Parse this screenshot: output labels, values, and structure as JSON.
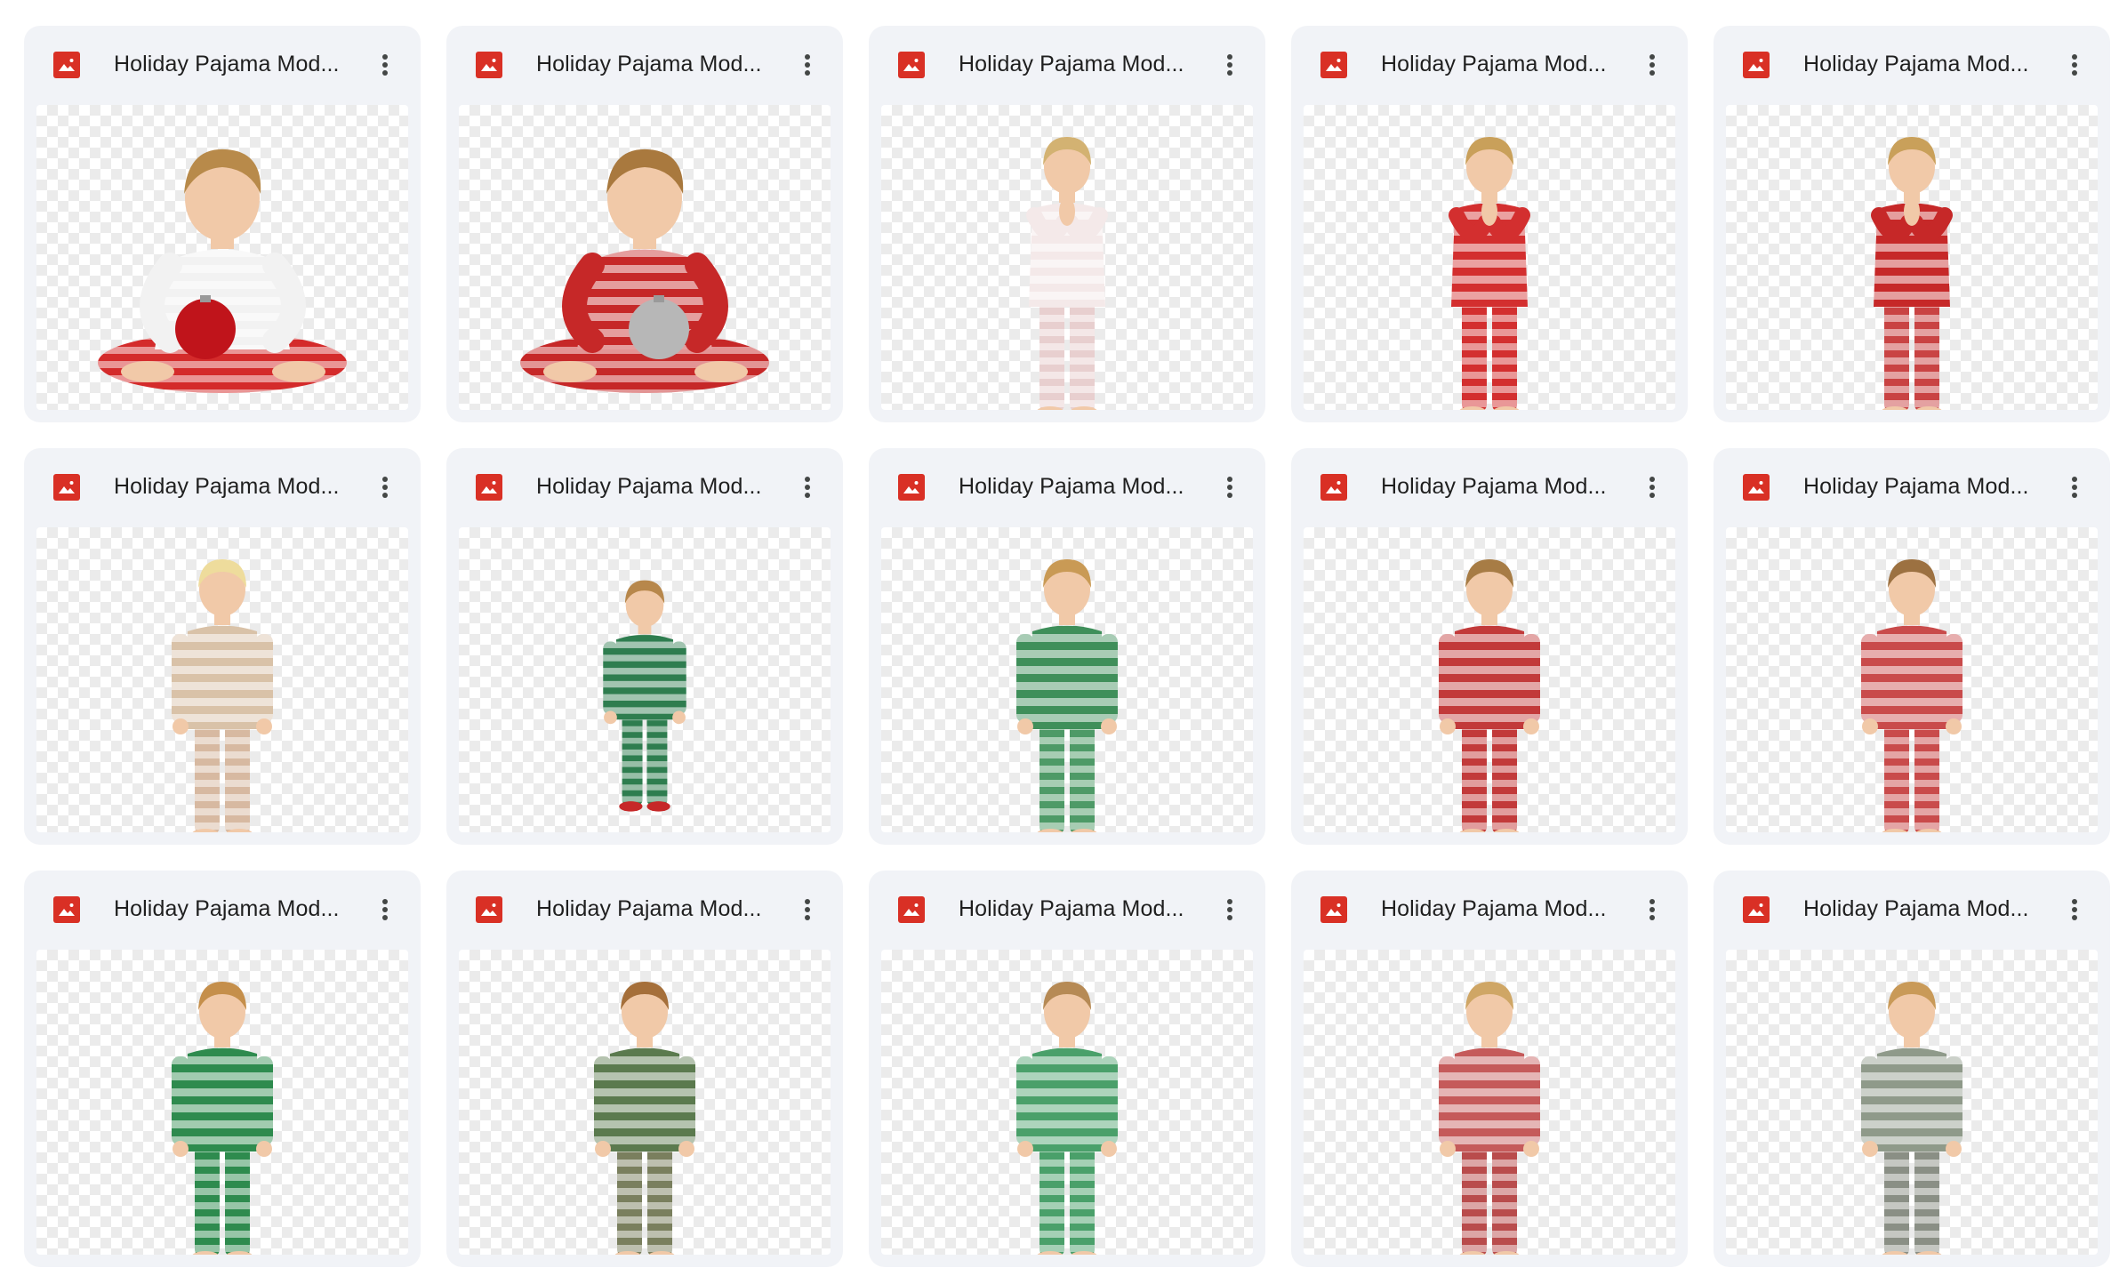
{
  "files": [
    {
      "title": "Holiday Pajama Mod...",
      "icon": "image-file-icon",
      "pose": "sitting-ornament",
      "top": "#f2f2f2",
      "pants": "#d42b2b",
      "hair": "#b88a4a"
    },
    {
      "title": "Holiday Pajama Mod...",
      "icon": "image-file-icon",
      "pose": "sitting-ornament",
      "top": "#c62828",
      "pants": "#c62828",
      "hair": "#a9793e"
    },
    {
      "title": "Holiday Pajama Mod...",
      "icon": "image-file-icon",
      "pose": "standing-praying",
      "top": "#f4e9e9",
      "pants": "#e8cfcf",
      "hair": "#d3b272"
    },
    {
      "title": "Holiday Pajama Mod...",
      "icon": "image-file-icon",
      "pose": "standing-praying",
      "top": "#d32f2f",
      "pants": "#d32f2f",
      "hair": "#c9a05a"
    },
    {
      "title": "Holiday Pajama Mod...",
      "icon": "image-file-icon",
      "pose": "standing-praying",
      "top": "#c62828",
      "pants": "#c94343",
      "hair": "#c9a05a"
    },
    {
      "title": "Holiday Pajama Mod...",
      "icon": "image-file-icon",
      "pose": "standing",
      "top": "#d9c2a8",
      "pants": "#d7b9a1",
      "hair": "#eedc9c"
    },
    {
      "title": "Holiday Pajama Mod...",
      "icon": "image-file-icon",
      "pose": "standing-small",
      "top": "#2e7d4f",
      "pants": "#2e7d4f",
      "hair": "#b7874b"
    },
    {
      "title": "Holiday Pajama Mod...",
      "icon": "image-file-icon",
      "pose": "standing",
      "top": "#3f8f5a",
      "pants": "#4e9a67",
      "hair": "#c99a55"
    },
    {
      "title": "Holiday Pajama Mod...",
      "icon": "image-file-icon",
      "pose": "standing",
      "top": "#c23a3a",
      "pants": "#c23a3a",
      "hair": "#a77c45"
    },
    {
      "title": "Holiday Pajama Mod...",
      "icon": "image-file-icon",
      "pose": "standing",
      "top": "#c94b4b",
      "pants": "#c94b4b",
      "hair": "#9c7141"
    },
    {
      "title": "Holiday Pajama Mod...",
      "icon": "image-file-icon",
      "pose": "standing",
      "top": "#2e8b4e",
      "pants": "#2e8b4e",
      "hair": "#c58f4b"
    },
    {
      "title": "Holiday Pajama Mod...",
      "icon": "image-file-icon",
      "pose": "standing",
      "top": "#5b7a4e",
      "pants": "#7a7f5e",
      "hair": "#a56f3a"
    },
    {
      "title": "Holiday Pajama Mod...",
      "icon": "image-file-icon",
      "pose": "standing",
      "top": "#4aa06a",
      "pants": "#4aa06a",
      "hair": "#b68a55"
    },
    {
      "title": "Holiday Pajama Mod...",
      "icon": "image-file-icon",
      "pose": "standing",
      "top": "#c55a5a",
      "pants": "#b94c4c",
      "hair": "#cfa665"
    },
    {
      "title": "Holiday Pajama Mod...",
      "icon": "image-file-icon",
      "pose": "standing",
      "top": "#8f9a8a",
      "pants": "#8a8f85",
      "hair": "#c99a58"
    }
  ],
  "colors": {
    "card_background": "#f1f3f7",
    "file_icon_red": "#d93025",
    "title_text": "#1f1f1f",
    "more_icon": "#444746"
  },
  "more_icon": "more-vert-icon"
}
